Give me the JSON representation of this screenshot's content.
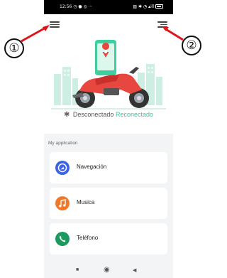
{
  "status_bar": {
    "time": "12:56",
    "left_icons": "◷ ● ◎ ···",
    "right_icons": "▨ ✱ ◔ ▴ill"
  },
  "header": {
    "left_menu_icon": "hamburger-menu-icon",
    "right_menu_icon": "settings-menu-icon"
  },
  "connection": {
    "bluetooth_icon": "✱",
    "disconnected_label": "Desconectado",
    "reconnect_label": "Reconectado"
  },
  "applications": {
    "section_title": "My application",
    "items": [
      {
        "label": "Navegación",
        "icon": "navigation-icon",
        "color": "#3b63e6"
      },
      {
        "label": "Musica",
        "icon": "music-icon",
        "color": "#f07a2a"
      },
      {
        "label": "Teléfono",
        "icon": "phone-icon",
        "color": "#1a9a5c"
      }
    ]
  },
  "nav_bar": {
    "recent": "■",
    "home": "◉",
    "back": "◀"
  },
  "callouts": {
    "left": "①",
    "right": "②"
  },
  "colors": {
    "accent": "#35c2a0",
    "callout_arrow": "#e0141a",
    "motorcycle": "#e8473f"
  }
}
